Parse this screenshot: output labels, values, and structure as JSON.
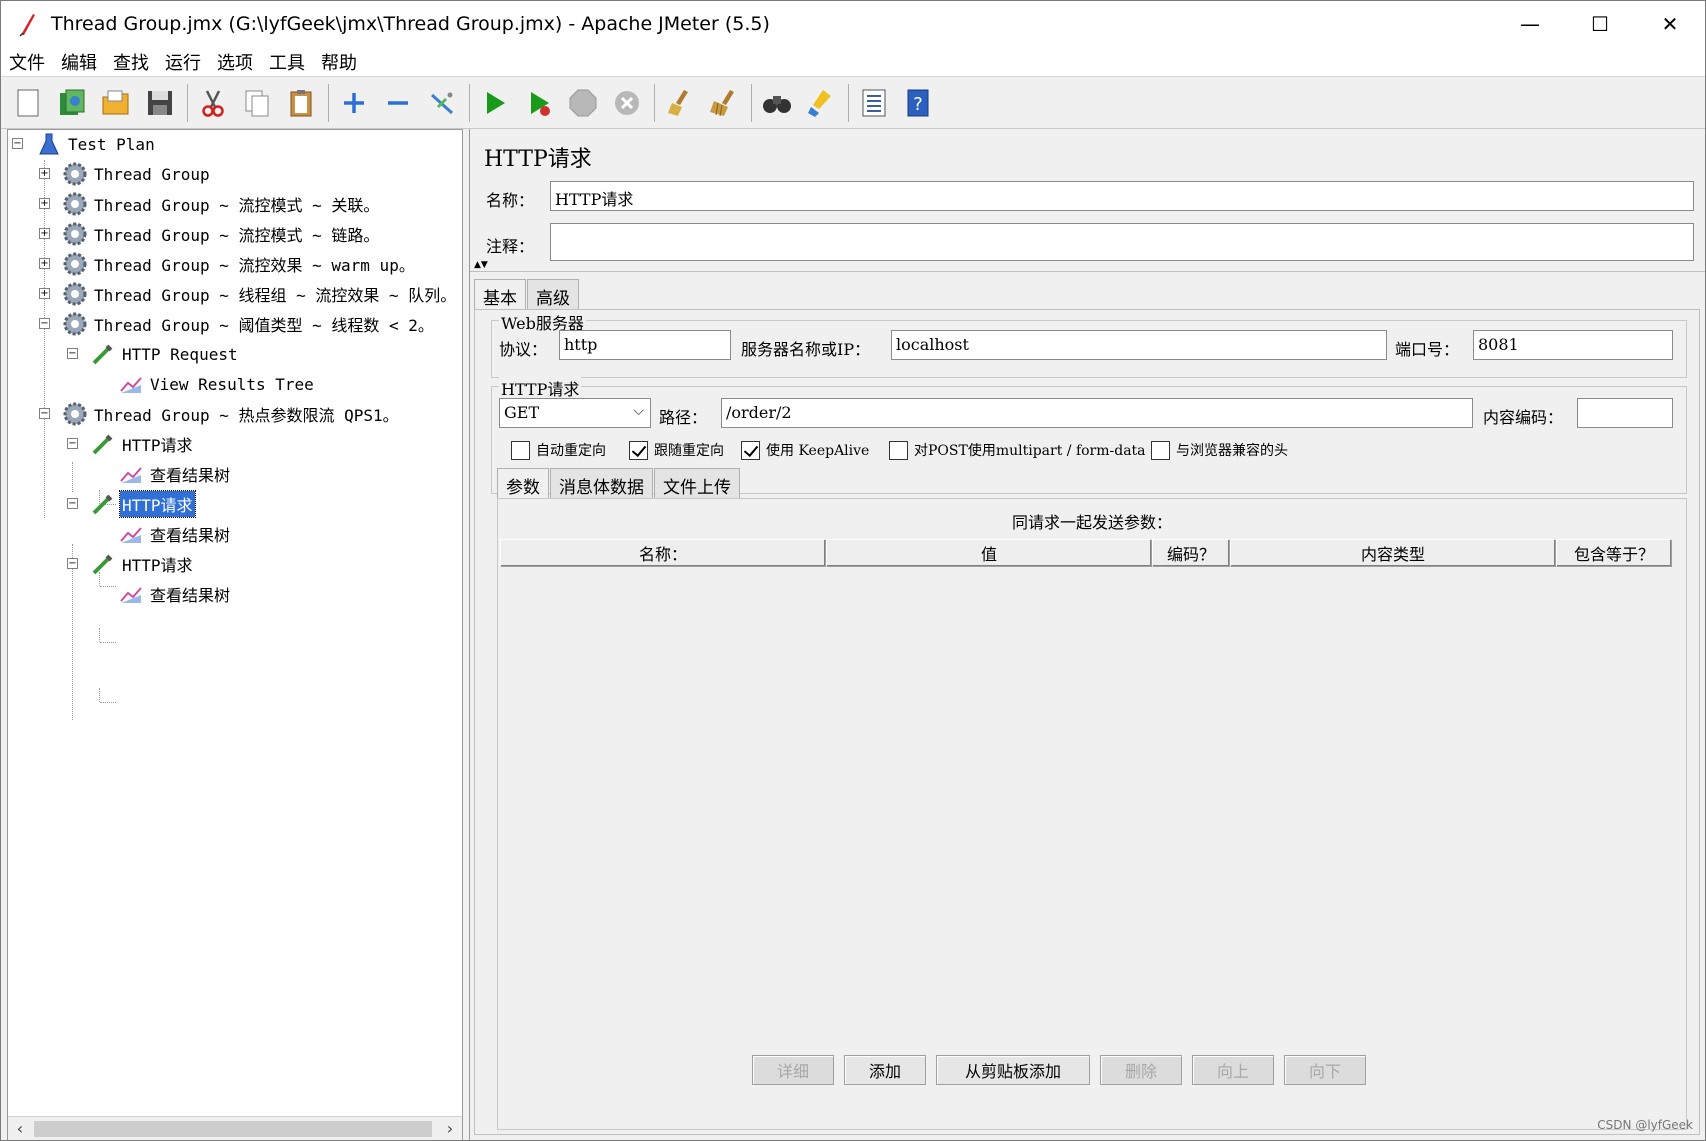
{
  "window": {
    "title": "Thread Group.jmx (G:\\lyfGeek\\jmx\\Thread Group.jmx) - Apache JMeter (5.5)",
    "minimize": "—",
    "maximize": "☐",
    "close": "✕"
  },
  "menu": [
    "文件",
    "编辑",
    "查找",
    "运行",
    "选项",
    "工具",
    "帮助"
  ],
  "toolbar": [
    "new-icon",
    "templates-icon",
    "open-icon",
    "save-icon",
    "cut-icon",
    "copy-icon",
    "paste-icon",
    "expand-icon",
    "collapse-icon",
    "toggle-icon",
    "start-icon",
    "start-no-pauses-icon",
    "stop-icon",
    "shutdown-icon",
    "clear-icon",
    "clear-all-icon",
    "search-icon",
    "reset-search-icon",
    "function-helper-icon",
    "help-icon"
  ],
  "tree": {
    "nodes": [
      {
        "label": "Test Plan"
      },
      {
        "label": "Thread Group"
      },
      {
        "label": "Thread Group ~ 流控模式 ~ 关联。"
      },
      {
        "label": "Thread Group ~ 流控模式 ~ 链路。"
      },
      {
        "label": "Thread Group ~ 流控效果 ~ warm up。"
      },
      {
        "label": "Thread Group ~ 线程组 ~ 流控效果 ~ 队列。"
      },
      {
        "label": "Thread Group ~ 阈值类型 ~ 线程数 < 2。"
      },
      {
        "label": "HTTP Request"
      },
      {
        "label": "View Results Tree"
      },
      {
        "label": "Thread Group ~ 热点参数限流 QPS1。"
      },
      {
        "label": "HTTP请求"
      },
      {
        "label": "查看结果树"
      },
      {
        "label": "HTTP请求"
      },
      {
        "label": "查看结果树"
      },
      {
        "label": "HTTP请求"
      },
      {
        "label": "查看结果树"
      }
    ]
  },
  "panel": {
    "title": "HTTP请求",
    "name_label": "名称：",
    "name_value": "HTTP请求",
    "comment_label": "注释：",
    "comment_value": "",
    "tabs": [
      "基本",
      "高级"
    ],
    "web_server": {
      "title": "Web服务器",
      "protocol_label": "协议：",
      "protocol_value": "http",
      "server_label": "服务器名称或IP：",
      "server_value": "localhost",
      "port_label": "端口号：",
      "port_value": "8081"
    },
    "http_request": {
      "title": "HTTP请求",
      "method": "GET",
      "path_label": "路径：",
      "path_value": "/order/2",
      "encoding_label": "内容编码：",
      "encoding_value": ""
    },
    "checkboxes": [
      {
        "label": "自动重定向",
        "checked": false
      },
      {
        "label": "跟随重定向",
        "checked": true
      },
      {
        "label": "使用 KeepAlive",
        "checked": true
      },
      {
        "label": "对POST使用multipart / form-data",
        "checked": false
      },
      {
        "label": "与浏览器兼容的头",
        "checked": false
      }
    ],
    "sub_tabs": [
      "参数",
      "消息体数据",
      "文件上传"
    ],
    "args_caption": "同请求一起发送参数：",
    "columns": [
      "名称：",
      "值",
      "编码？",
      "内容类型",
      "包含等于？"
    ],
    "buttons": [
      {
        "label": "详细",
        "enabled": false
      },
      {
        "label": "添加",
        "enabled": true
      },
      {
        "label": "从剪贴板添加",
        "enabled": true
      },
      {
        "label": "删除",
        "enabled": false
      },
      {
        "label": "向上",
        "enabled": false
      },
      {
        "label": "向下",
        "enabled": false
      }
    ]
  },
  "watermark": "CSDN @lyfGeek",
  "colors": {
    "selection": "#2f6fd6",
    "start_green": "#1a9a1a"
  }
}
